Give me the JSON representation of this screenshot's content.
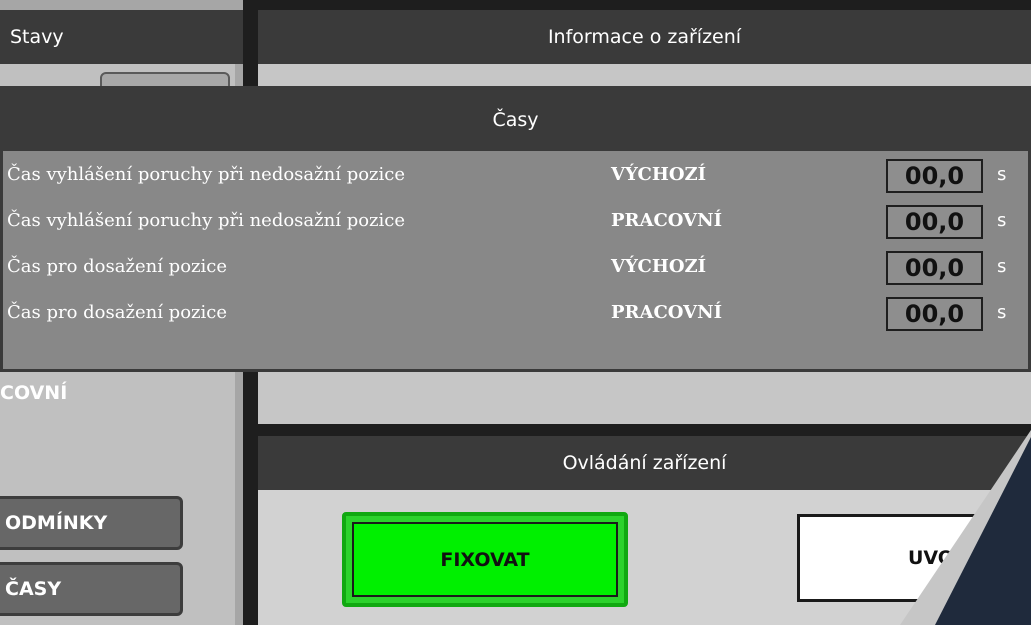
{
  "left_panel": {
    "header": "Stavy",
    "state_text": "COVNÍ",
    "buttons": {
      "conditions": "ODMÍNKY",
      "times": "ČASY"
    }
  },
  "info_panel": {
    "header": "Informace o zařízení"
  },
  "control_panel": {
    "header": "Ovládání zařízení",
    "fix_button": "FIXOVAT",
    "release_button": "UVOLI"
  },
  "times_dialog": {
    "header": "Časy",
    "rows": [
      {
        "label": "Čas vyhlášení poruchy při nedosažní pozice",
        "position": "VÝCHOZÍ",
        "value": "00,0",
        "unit": "s"
      },
      {
        "label": "Čas vyhlášení poruchy při nedosažní pozice",
        "position": "PRACOVNÍ",
        "value": "00,0",
        "unit": "s"
      },
      {
        "label": "Čas pro dosažení pozice",
        "position": "VÝCHOZÍ",
        "value": "00,0",
        "unit": "s"
      },
      {
        "label": "Čas pro dosažení pozice",
        "position": "PRACOVNÍ",
        "value": "00,0",
        "unit": "s"
      }
    ]
  },
  "colors": {
    "header_bg": "#3a3a3a",
    "dialog_bg": "#888888",
    "fix_active": "#00f000",
    "accent_stripe": "#1f2a3c"
  }
}
